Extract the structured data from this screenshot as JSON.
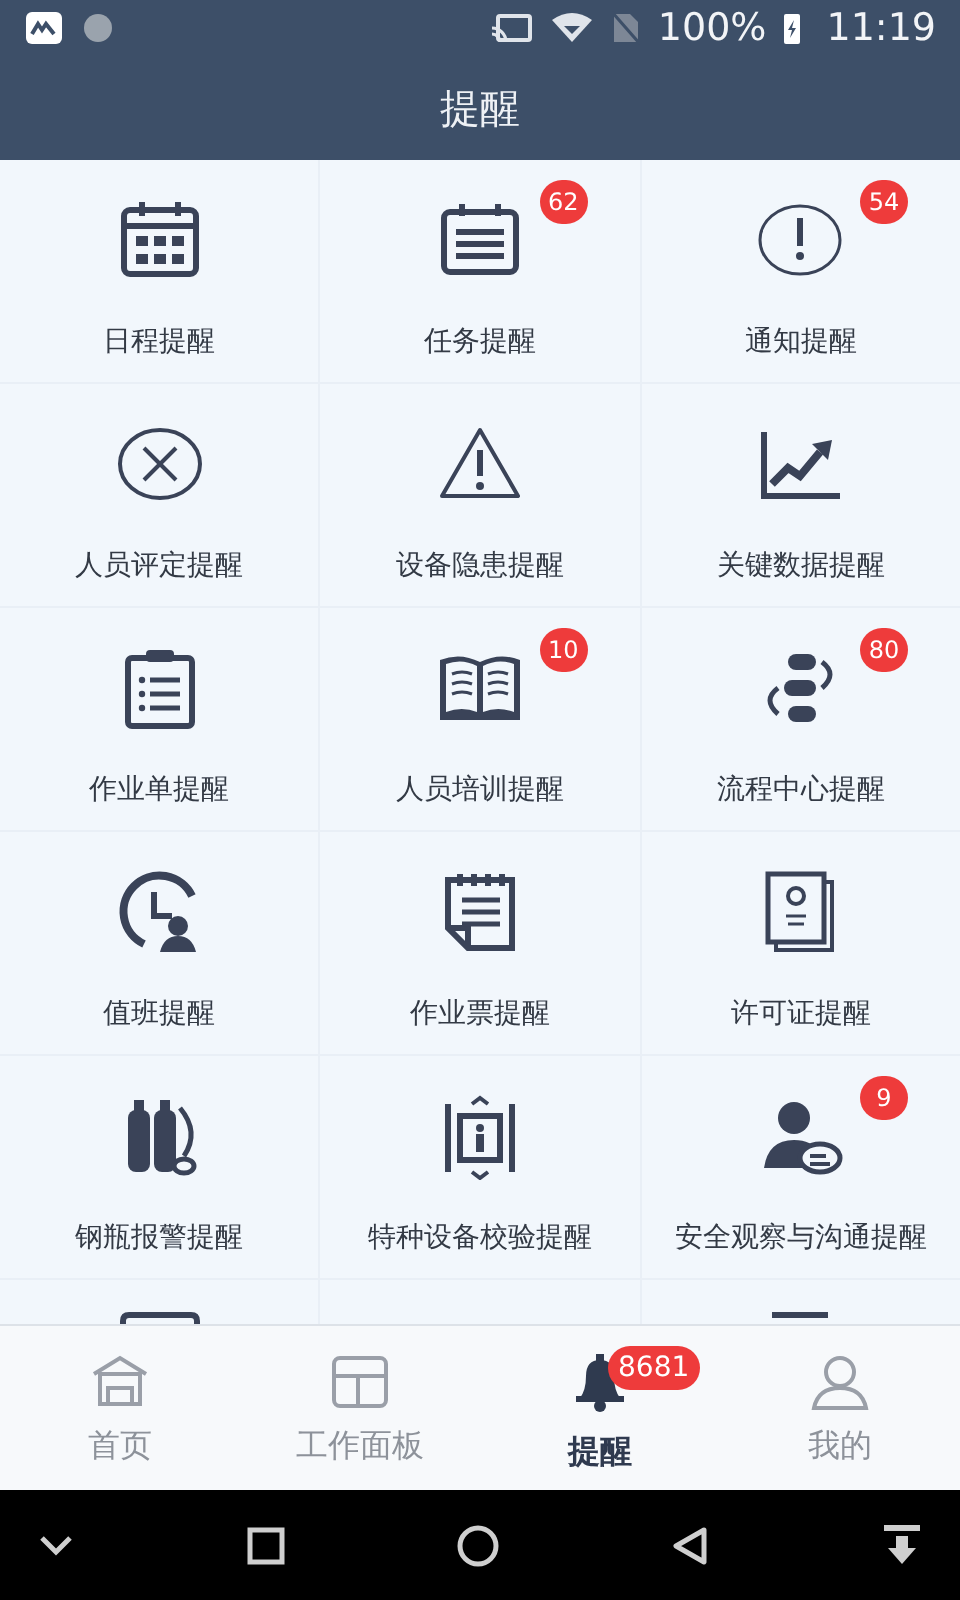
{
  "status_bar": {
    "battery": "100%",
    "time": "11:19"
  },
  "title": "提醒",
  "items": [
    {
      "kind": "tile",
      "label": "日程提醒"
    },
    {
      "kind": "tile",
      "label": "任务提醒",
      "badge": "62"
    },
    {
      "kind": "tile",
      "label": "通知提醒",
      "badge": "54"
    },
    {
      "kind": "tile",
      "label": "人员评定提醒"
    },
    {
      "kind": "tile",
      "label": "设备隐患提醒"
    },
    {
      "kind": "tile",
      "label": "关键数据提醒"
    },
    {
      "kind": "tile",
      "label": "作业单提醒"
    },
    {
      "kind": "tile",
      "label": "人员培训提醒",
      "badge": "10"
    },
    {
      "kind": "tile",
      "label": "流程中心提醒",
      "badge": "80"
    },
    {
      "kind": "tile",
      "label": "值班提醒"
    },
    {
      "kind": "tile",
      "label": "作业票提醒"
    },
    {
      "kind": "tile",
      "label": "许可证提醒"
    },
    {
      "kind": "tile",
      "label": "钢瓶报警提醒"
    },
    {
      "kind": "tile",
      "label": "特种设备校验提醒"
    },
    {
      "kind": "tile",
      "label": "安全观察与沟通提醒",
      "badge": "9"
    },
    {
      "kind": "cut"
    },
    {
      "kind": "cut"
    },
    {
      "kind": "cut"
    }
  ],
  "tabs": [
    {
      "label": "首页",
      "selected": false
    },
    {
      "label": "工作面板",
      "selected": false
    },
    {
      "label": "提醒",
      "selected": true,
      "badge": "8681"
    },
    {
      "label": "我的",
      "selected": false
    }
  ]
}
